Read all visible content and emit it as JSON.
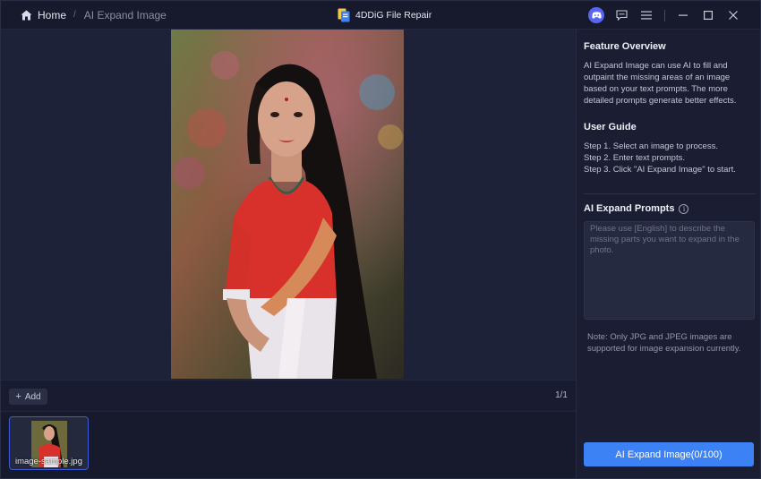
{
  "titlebar": {
    "home_label": "Home",
    "separator": "/",
    "current_page": "AI Expand Image",
    "app_name": "4DDiG File Repair"
  },
  "colors": {
    "accent": "#3d82f5",
    "discord": "#5865f2",
    "background": "#171a2d"
  },
  "icons": {
    "home": "home-icon",
    "app_logo": "file-repair-logo",
    "discord": "discord-icon",
    "feedback": "feedback-icon",
    "menu": "hamburger-menu-icon",
    "minimize": "minimize-icon",
    "maximize": "maximize-icon",
    "close": "close-icon",
    "info": "info-icon"
  },
  "toolbar": {
    "add_label": "Add",
    "page_count": "1/1"
  },
  "thumbnails": [
    {
      "filename": "image-sample.jpg",
      "selected": true
    }
  ],
  "panel": {
    "overview_title": "Feature Overview",
    "overview_text": "AI Expand Image can use AI to fill and outpaint the missing areas of an image based on your text prompts. The more detailed prompts generate better effects.",
    "guide_title": "User Guide",
    "guide_steps": [
      "Step 1. Select an image to process.",
      "Step 2. Enter text prompts.",
      "Step 3. Click \"AI Expand Image\" to start."
    ],
    "prompts_title": "AI Expand Prompts",
    "prompts_placeholder": "Please use [English] to describe the missing parts you want to expand in the photo.",
    "note": "Note: Only JPG and JPEG images are supported for image expansion currently.",
    "expand_button": "AI Expand Image(0/100)"
  }
}
